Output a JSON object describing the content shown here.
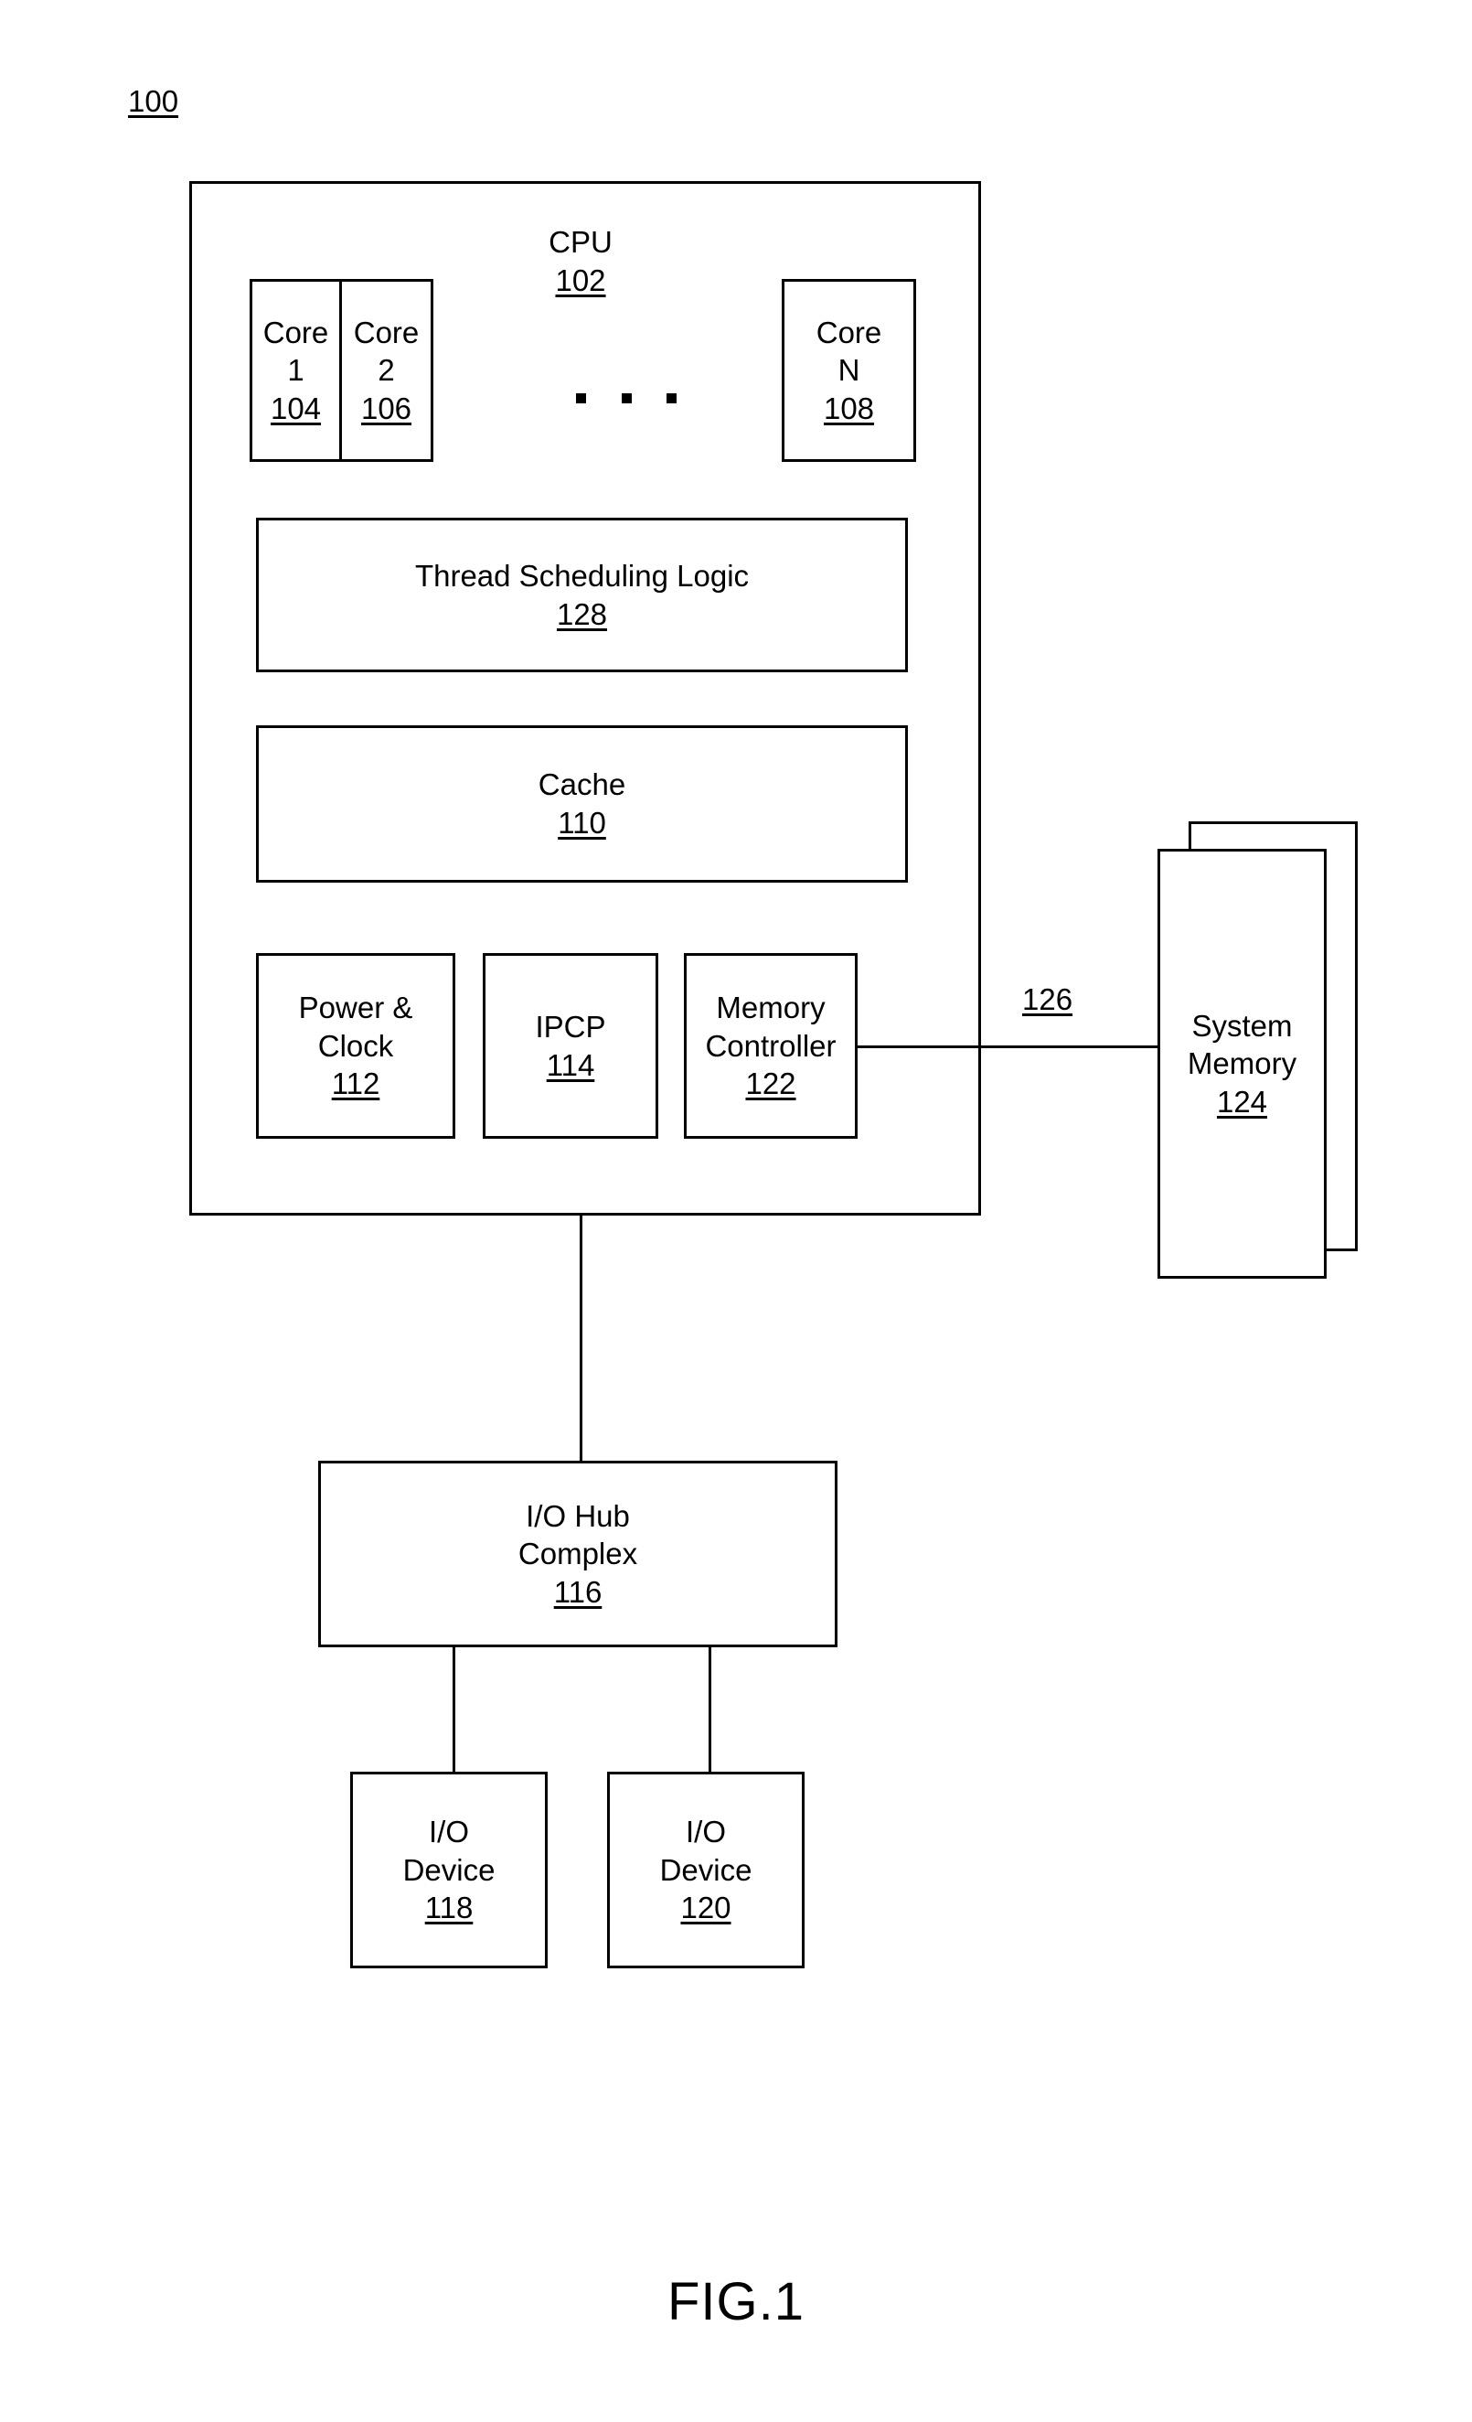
{
  "figure": {
    "system_ref": "100",
    "caption": "FIG.1"
  },
  "cpu": {
    "label": "CPU",
    "ref": "102",
    "cores": [
      {
        "name_line1": "Core",
        "name_line2": "1",
        "ref": "104"
      },
      {
        "name_line1": "Core",
        "name_line2": "2",
        "ref": "106"
      },
      {
        "name_line1": "Core",
        "name_line2": "N",
        "ref": "108"
      }
    ],
    "ellipsis": "· · ·",
    "thread_scheduling_logic": {
      "label": "Thread Scheduling Logic",
      "ref": "128"
    },
    "cache": {
      "label": "Cache",
      "ref": "110"
    },
    "power_clock": {
      "line1": "Power &",
      "line2": "Clock",
      "ref": "112"
    },
    "ipcp": {
      "label": "IPCP",
      "ref": "114"
    },
    "memory_controller": {
      "line1": "Memory",
      "line2": "Controller",
      "ref": "122"
    }
  },
  "system_memory": {
    "line1": "System",
    "line2": "Memory",
    "ref": "124"
  },
  "bus": {
    "memory_bus_ref": "126"
  },
  "io_hub_complex": {
    "line1": "I/O Hub",
    "line2": "Complex",
    "ref": "116"
  },
  "io_devices": [
    {
      "line1": "I/O",
      "line2": "Device",
      "ref": "118"
    },
    {
      "line1": "I/O",
      "line2": "Device",
      "ref": "120"
    }
  ],
  "colors": {
    "ink": "#000000",
    "paper": "#ffffff"
  }
}
